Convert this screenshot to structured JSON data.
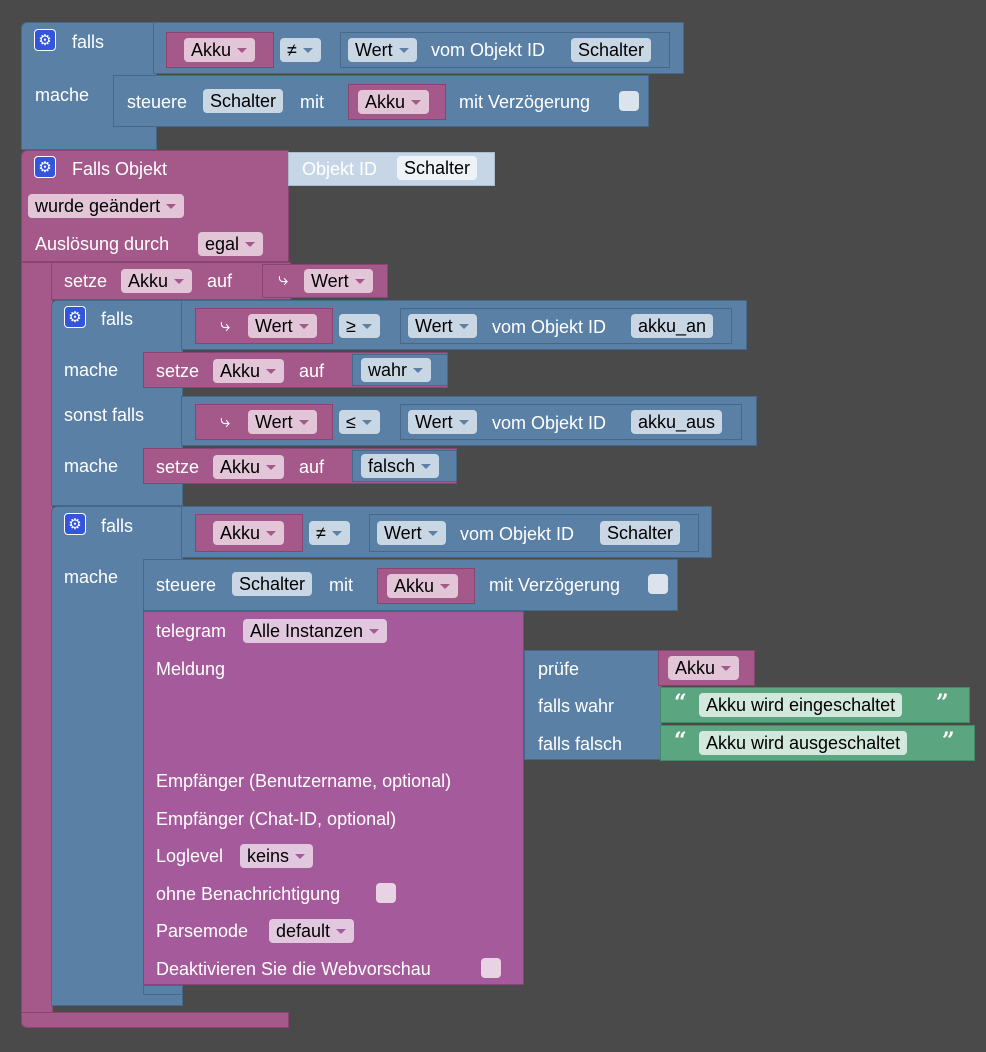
{
  "block1": {
    "if_label": "falls",
    "do_label": "mache",
    "cond_var": "Akku",
    "cond_op": "≠",
    "cond_prop": "Wert",
    "cond_obj_label": "vom Objekt ID",
    "cond_obj_id": "Schalter",
    "stmt_label": "steuere",
    "stmt_target": "Schalter",
    "stmt_with": "mit",
    "stmt_var": "Akku",
    "stmt_delay": "mit Verzögerung"
  },
  "trigger": {
    "title": "Falls Objekt",
    "object_label": "Objekt ID",
    "object_id": "Schalter",
    "event": "wurde geändert",
    "trigger_label": "Auslösung durch",
    "trigger_value": "egal"
  },
  "set1": {
    "label": "setze",
    "var": "Akku",
    "on": "auf",
    "value": "Wert",
    "value_icon": "⤷"
  },
  "if2": {
    "if_label": "falls",
    "do_label": "mache",
    "elseif_label": "sonst falls",
    "c1_value": "Wert",
    "c1_op": "≥",
    "c1_prop": "Wert",
    "c1_obj_label": "vom Objekt ID",
    "c1_obj_id": "akku_an",
    "s1_label": "setze",
    "s1_var": "Akku",
    "s1_on": "auf",
    "s1_value": "wahr",
    "c2_value": "Wert",
    "c2_op": "≤",
    "c2_prop": "Wert",
    "c2_obj_label": "vom Objekt ID",
    "c2_obj_id": "akku_aus",
    "s2_label": "setze",
    "s2_var": "Akku",
    "s2_on": "auf",
    "s2_value": "falsch",
    "icon": "⤷"
  },
  "if3": {
    "if_label": "falls",
    "do_label": "mache",
    "cond_var": "Akku",
    "cond_op": "≠",
    "cond_prop": "Wert",
    "cond_obj_label": "vom Objekt ID",
    "cond_obj_id": "Schalter",
    "stmt_label": "steuere",
    "stmt_target": "Schalter",
    "stmt_with": "mit",
    "stmt_var": "Akku",
    "stmt_delay": "mit Verzögerung"
  },
  "telegram": {
    "label": "telegram",
    "instance": "Alle Instanzen",
    "message_label": "Meldung",
    "ternary_check": "prüfe",
    "ternary_check_var": "Akku",
    "ternary_true": "falls wahr",
    "ternary_true_text": "Akku wird eingeschaltet",
    "ternary_false": "falls falsch",
    "ternary_false_text": "Akku wird ausgeschaltet",
    "recipient_user": "Empfänger (Benutzername, optional)",
    "recipient_chat": "Empfänger (Chat-ID, optional)",
    "loglevel_label": "Loglevel",
    "loglevel_value": "keins",
    "silent_label": "ohne Benachrichtigung",
    "parsemode_label": "Parsemode",
    "parsemode_value": "default",
    "preview_label": "Deaktivieren Sie die Webvorschau",
    "quote_open": "“",
    "quote_close": "”"
  },
  "icons": {
    "gear": "⚙"
  },
  "colors": {
    "logic": "#5b80a5",
    "variable": "#a5598b",
    "telegram": "#a55b9b",
    "text": "#5ba580",
    "workspace": "#4a4a4a"
  }
}
